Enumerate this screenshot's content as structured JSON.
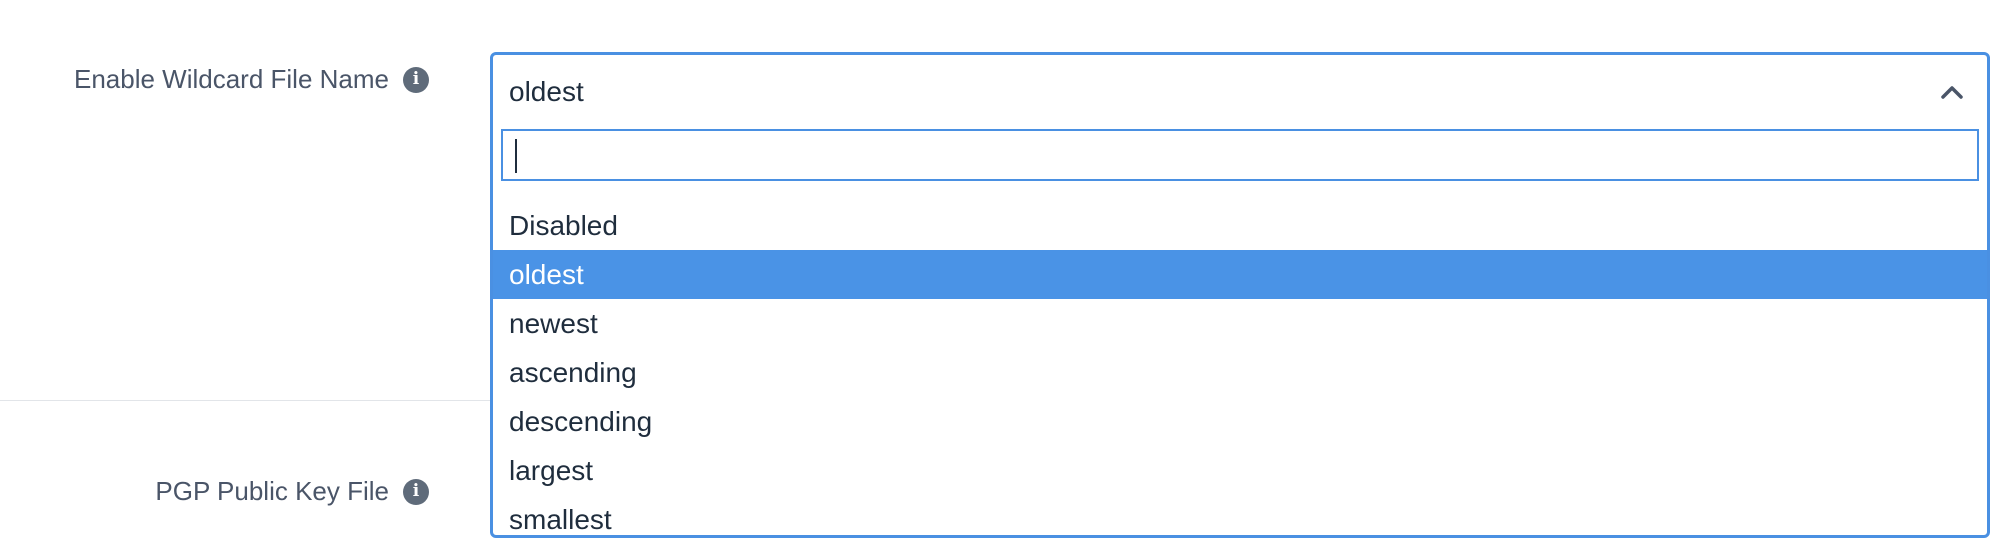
{
  "fields": {
    "wildcard_label": "Enable Wildcard File Name",
    "pgp_label": "PGP Public Key File"
  },
  "icons": {
    "info": "info-icon",
    "chevron": "chevron-up-icon"
  },
  "select": {
    "current_value": "oldest",
    "search_value": "",
    "search_placeholder": "",
    "selected_index": 1,
    "options": [
      {
        "label": "Disabled"
      },
      {
        "label": "oldest"
      },
      {
        "label": "newest"
      },
      {
        "label": "ascending"
      },
      {
        "label": "descending"
      },
      {
        "label": "largest"
      },
      {
        "label": "smallest"
      }
    ]
  },
  "colors": {
    "accent": "#4a90e2",
    "selected_bg": "#4a93e6",
    "label_text": "#4a5568"
  }
}
